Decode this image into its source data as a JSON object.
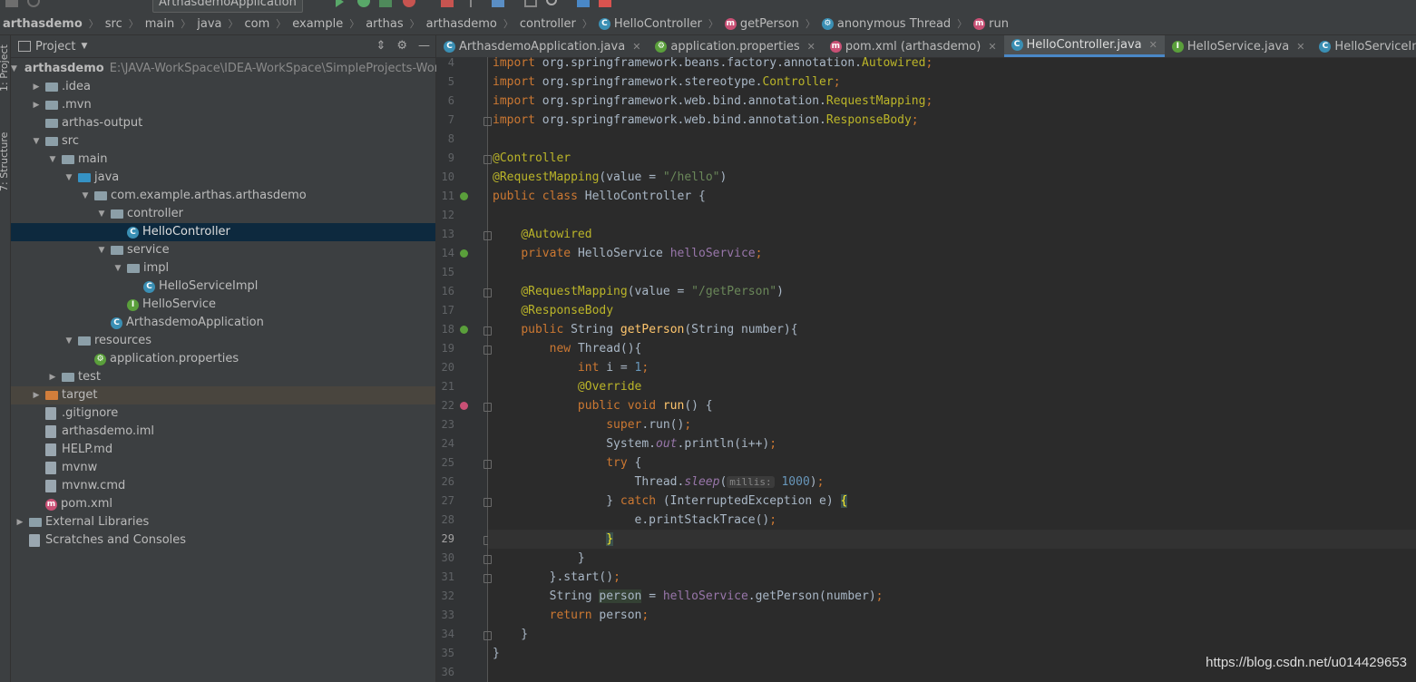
{
  "toolbar": {
    "run_config": "ArthasdemoApplication"
  },
  "breadcrumb": [
    {
      "label": "arthasdemo",
      "icon": ""
    },
    {
      "label": "src",
      "icon": ""
    },
    {
      "label": "main",
      "icon": ""
    },
    {
      "label": "java",
      "icon": ""
    },
    {
      "label": "com",
      "icon": ""
    },
    {
      "label": "example",
      "icon": ""
    },
    {
      "label": "arthas",
      "icon": ""
    },
    {
      "label": "arthasdemo",
      "icon": ""
    },
    {
      "label": "controller",
      "icon": ""
    },
    {
      "label": "HelloController",
      "icon": "class-icon"
    },
    {
      "label": "getPerson",
      "icon": "method-icon"
    },
    {
      "label": "anonymous Thread",
      "icon": "anonymous-class-icon"
    },
    {
      "label": "run",
      "icon": "method-icon"
    }
  ],
  "side_tools": {
    "project": "1: Project",
    "structure": "7: Structure"
  },
  "project_panel": {
    "title": "Project",
    "tree": [
      {
        "label": "arthasdemo",
        "hint": "E:\\JAVA-WorkSpace\\IDEA-WorkSpace\\SimpleProjects-Works",
        "depth": 0,
        "arrow": "▼",
        "icon": "module-folder-icon",
        "bold": true
      },
      {
        "label": ".idea",
        "depth": 1,
        "arrow": "▶",
        "icon": "folder-icon"
      },
      {
        "label": ".mvn",
        "depth": 1,
        "arrow": "▶",
        "icon": "folder-icon"
      },
      {
        "label": "arthas-output",
        "depth": 1,
        "arrow": "",
        "icon": "folder-icon"
      },
      {
        "label": "src",
        "depth": 1,
        "arrow": "▼",
        "icon": "folder-icon"
      },
      {
        "label": "main",
        "depth": 2,
        "arrow": "▼",
        "icon": "folder-icon"
      },
      {
        "label": "java",
        "depth": 3,
        "arrow": "▼",
        "icon": "source-folder-icon"
      },
      {
        "label": "com.example.arthas.arthasdemo",
        "depth": 4,
        "arrow": "▼",
        "icon": "package-icon"
      },
      {
        "label": "controller",
        "depth": 5,
        "arrow": "▼",
        "icon": "package-icon"
      },
      {
        "label": "HelloController",
        "depth": 6,
        "arrow": "",
        "icon": "class-icon",
        "selected": true
      },
      {
        "label": "service",
        "depth": 5,
        "arrow": "▼",
        "icon": "package-icon"
      },
      {
        "label": "impl",
        "depth": 6,
        "arrow": "▼",
        "icon": "package-icon"
      },
      {
        "label": "HelloServiceImpl",
        "depth": 7,
        "arrow": "",
        "icon": "class-icon"
      },
      {
        "label": "HelloService",
        "depth": 6,
        "arrow": "",
        "icon": "interface-icon"
      },
      {
        "label": "ArthasdemoApplication",
        "depth": 5,
        "arrow": "",
        "icon": "spring-boot-class-icon"
      },
      {
        "label": "resources",
        "depth": 3,
        "arrow": "▼",
        "icon": "resources-folder-icon"
      },
      {
        "label": "application.properties",
        "depth": 4,
        "arrow": "",
        "icon": "properties-file-icon"
      },
      {
        "label": "test",
        "depth": 2,
        "arrow": "▶",
        "icon": "folder-icon"
      },
      {
        "label": "target",
        "depth": 1,
        "arrow": "▶",
        "icon": "excluded-folder-icon",
        "excluded": true
      },
      {
        "label": ".gitignore",
        "depth": 1,
        "arrow": "",
        "icon": "gitignore-file-icon"
      },
      {
        "label": "arthasdemo.iml",
        "depth": 1,
        "arrow": "",
        "icon": "iml-file-icon"
      },
      {
        "label": "HELP.md",
        "depth": 1,
        "arrow": "",
        "icon": "markdown-file-icon"
      },
      {
        "label": "mvnw",
        "depth": 1,
        "arrow": "",
        "icon": "script-file-icon"
      },
      {
        "label": "mvnw.cmd",
        "depth": 1,
        "arrow": "",
        "icon": "script-file-icon"
      },
      {
        "label": "pom.xml",
        "depth": 1,
        "arrow": "",
        "icon": "maven-file-icon"
      },
      {
        "label": "External Libraries",
        "depth": 0,
        "arrow": "▶",
        "icon": "libraries-icon"
      },
      {
        "label": "Scratches and Consoles",
        "depth": 0,
        "arrow": "",
        "icon": "scratches-icon"
      }
    ]
  },
  "tabs": [
    {
      "label": "ArthasdemoApplication.java",
      "icon": "spring-boot-class-icon",
      "active": false
    },
    {
      "label": "application.properties",
      "icon": "properties-file-icon",
      "active": false
    },
    {
      "label": "pom.xml (arthasdemo)",
      "icon": "maven-file-icon",
      "active": false
    },
    {
      "label": "HelloController.java",
      "icon": "class-icon",
      "active": true
    },
    {
      "label": "HelloService.java",
      "icon": "interface-icon",
      "active": false
    },
    {
      "label": "HelloServiceImpl.java",
      "icon": "class-icon",
      "active": false
    }
  ],
  "editor": {
    "current_line": 29,
    "lines": [
      {
        "n": 4,
        "t": [
          [
            "kw",
            "import "
          ],
          [
            "",
            "org.springframework.beans.factory.annotation."
          ],
          [
            "an",
            "Autowired"
          ],
          [
            "kw",
            ";"
          ]
        ]
      },
      {
        "n": 5,
        "t": [
          [
            "kw",
            "import "
          ],
          [
            "",
            "org.springframework.stereotype."
          ],
          [
            "an",
            "Controller"
          ],
          [
            "kw",
            ";"
          ]
        ]
      },
      {
        "n": 6,
        "t": [
          [
            "kw",
            "import "
          ],
          [
            "",
            "org.springframework.web.bind.annotation."
          ],
          [
            "an",
            "RequestMapping"
          ],
          [
            "kw",
            ";"
          ]
        ]
      },
      {
        "n": 7,
        "t": [
          [
            "kw",
            "import "
          ],
          [
            "",
            "org.springframework.web.bind.annotation."
          ],
          [
            "an",
            "ResponseBody"
          ],
          [
            "kw",
            ";"
          ]
        ]
      },
      {
        "n": 8,
        "t": []
      },
      {
        "n": 9,
        "t": [
          [
            "an",
            "@Controller"
          ]
        ]
      },
      {
        "n": 10,
        "t": [
          [
            "an",
            "@RequestMapping"
          ],
          [
            "",
            "(value = "
          ],
          [
            "str",
            "\"/hello\""
          ],
          [
            "",
            ")"
          ]
        ]
      },
      {
        "n": 11,
        "t": [
          [
            "kw",
            "public class "
          ],
          [
            "",
            "HelloController {"
          ]
        ]
      },
      {
        "n": 12,
        "t": []
      },
      {
        "n": 13,
        "t": [
          [
            "",
            "    "
          ],
          [
            "an",
            "@Autowired"
          ]
        ]
      },
      {
        "n": 14,
        "t": [
          [
            "",
            "    "
          ],
          [
            "kw",
            "private "
          ],
          [
            "",
            "HelloService "
          ],
          [
            "fld",
            "helloService"
          ],
          [
            "kw",
            ";"
          ]
        ]
      },
      {
        "n": 15,
        "t": []
      },
      {
        "n": 16,
        "t": [
          [
            "",
            "    "
          ],
          [
            "an",
            "@RequestMapping"
          ],
          [
            "",
            "(value = "
          ],
          [
            "str",
            "\"/getPerson\""
          ],
          [
            "",
            ")"
          ]
        ]
      },
      {
        "n": 17,
        "t": [
          [
            "",
            "    "
          ],
          [
            "an",
            "@ResponseBody"
          ]
        ]
      },
      {
        "n": 18,
        "t": [
          [
            "",
            "    "
          ],
          [
            "kw",
            "public "
          ],
          [
            "",
            "String "
          ],
          [
            "mth",
            "getPerson"
          ],
          [
            "",
            "(String number){"
          ]
        ]
      },
      {
        "n": 19,
        "t": [
          [
            "",
            "        "
          ],
          [
            "kw",
            "new "
          ],
          [
            "",
            "Thread(){"
          ]
        ]
      },
      {
        "n": 20,
        "t": [
          [
            "",
            "            "
          ],
          [
            "kw",
            "int "
          ],
          [
            "",
            "i = "
          ],
          [
            "num",
            "1"
          ],
          [
            "kw",
            ";"
          ]
        ]
      },
      {
        "n": 21,
        "t": [
          [
            "",
            "            "
          ],
          [
            "an",
            "@Override"
          ]
        ]
      },
      {
        "n": 22,
        "t": [
          [
            "",
            "            "
          ],
          [
            "kw",
            "public void "
          ],
          [
            "mth",
            "run"
          ],
          [
            "",
            "() {"
          ]
        ]
      },
      {
        "n": 23,
        "t": [
          [
            "",
            "                "
          ],
          [
            "kw",
            "super"
          ],
          [
            "",
            ".run()"
          ],
          [
            "kw",
            ";"
          ]
        ]
      },
      {
        "n": 24,
        "t": [
          [
            "",
            "                System."
          ],
          [
            "st",
            "out"
          ],
          [
            "",
            ".println(i++)"
          ],
          [
            "kw",
            ";"
          ]
        ]
      },
      {
        "n": 25,
        "t": [
          [
            "",
            "                "
          ],
          [
            "kw",
            "try "
          ],
          [
            "",
            "{"
          ]
        ]
      },
      {
        "n": 26,
        "t": [
          [
            "",
            "                    Thread."
          ],
          [
            "st",
            "sleep"
          ],
          [
            "",
            "("
          ],
          [
            "hint",
            "millis:"
          ],
          [
            "num",
            " 1000"
          ],
          [
            "",
            ")"
          ],
          [
            "kw",
            ";"
          ]
        ]
      },
      {
        "n": 27,
        "t": [
          [
            "",
            "                } "
          ],
          [
            "kw",
            "catch "
          ],
          [
            "",
            "(InterruptedException e) "
          ],
          [
            "brace",
            "{"
          ]
        ]
      },
      {
        "n": 28,
        "t": [
          [
            "",
            "                    e.printStackTrace()"
          ],
          [
            "kw",
            ";"
          ]
        ]
      },
      {
        "n": 29,
        "t": [
          [
            "",
            "                "
          ],
          [
            "brace",
            "}"
          ]
        ]
      },
      {
        "n": 30,
        "t": [
          [
            "",
            "            }"
          ]
        ]
      },
      {
        "n": 31,
        "t": [
          [
            "",
            "        }.start()"
          ],
          [
            "kw",
            ";"
          ]
        ]
      },
      {
        "n": 32,
        "t": [
          [
            "",
            "        String "
          ],
          [
            "pers",
            "person"
          ],
          [
            "",
            " = "
          ],
          [
            "fld",
            "helloService"
          ],
          [
            "",
            ".getPerson(number)"
          ],
          [
            "kw",
            ";"
          ]
        ]
      },
      {
        "n": 33,
        "t": [
          [
            "",
            "        "
          ],
          [
            "kw",
            "return "
          ],
          [
            "",
            "person"
          ],
          [
            "kw",
            ";"
          ]
        ]
      },
      {
        "n": 34,
        "t": [
          [
            "",
            "    }"
          ]
        ]
      },
      {
        "n": 35,
        "t": [
          [
            "",
            "}"
          ]
        ]
      },
      {
        "n": 36,
        "t": []
      }
    ],
    "gutter_icons": [
      {
        "line": 11,
        "icon": "spring-bean-icon"
      },
      {
        "line": 14,
        "icon": "spring-autowired-icon"
      },
      {
        "line": 18,
        "icon": "spring-mapping-icon"
      },
      {
        "line": 22,
        "icon": "override-method-icon"
      }
    ]
  },
  "watermark": "https://blog.csdn.net/u014429653",
  "colors": {
    "accent": "#4a88c7",
    "selection": "#0d293e",
    "keyword": "#cc7832",
    "annotation": "#bbb529",
    "string": "#6a8759",
    "method": "#ffc66d",
    "field": "#9876aa"
  }
}
